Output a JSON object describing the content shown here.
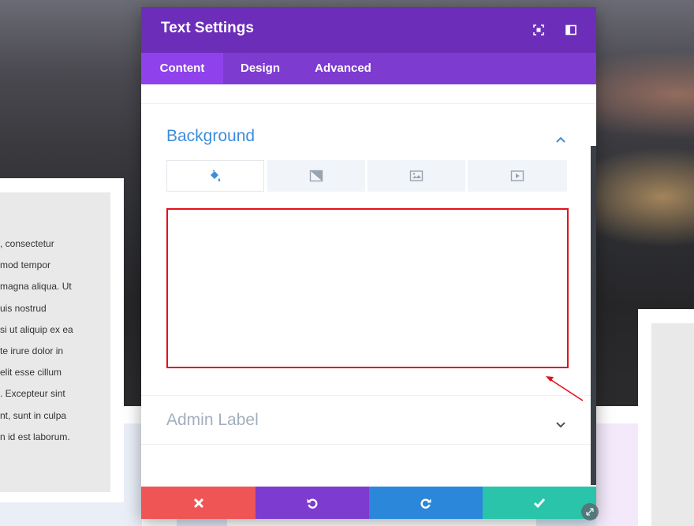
{
  "modal": {
    "title": "Text Settings",
    "header_icons": [
      "focus-icon",
      "split-view-icon"
    ],
    "tabs": [
      {
        "label": "Content",
        "active": true
      },
      {
        "label": "Design",
        "active": false
      },
      {
        "label": "Advanced",
        "active": false
      }
    ],
    "sections": {
      "background": {
        "title": "Background",
        "expanded": true
      },
      "admin_label": {
        "title": "Admin Label",
        "expanded": false
      }
    },
    "background_types": [
      "color-fill-icon",
      "gradient-icon",
      "image-icon",
      "video-icon"
    ],
    "footer_buttons": [
      {
        "name": "cancel-button",
        "icon": "close-icon",
        "color": "#ef5555"
      },
      {
        "name": "undo-button",
        "icon": "undo-icon",
        "color": "#7d3bcf"
      },
      {
        "name": "redo-button",
        "icon": "redo-icon",
        "color": "#2b87da"
      },
      {
        "name": "save-button",
        "icon": "check-icon",
        "color": "#29c4a9"
      }
    ]
  },
  "colors": {
    "header": "#6c2eb9",
    "tabs_bar": "#7e3bd0",
    "active_tab": "#8f42ec",
    "section_title_active": "#3e8ddd",
    "section_title_muted": "#a3aebd",
    "highlight": "#e2101c"
  },
  "background_page": {
    "text_lines": [
      ", consectetur",
      "mod tempor",
      "magna aliqua. Ut",
      "uis nostrud",
      "si ut aliquip ex ea",
      "te irure dolor in",
      "elit esse cillum",
      ". Excepteur sint",
      "nt, sunt in culpa",
      "n id est laborum."
    ]
  }
}
